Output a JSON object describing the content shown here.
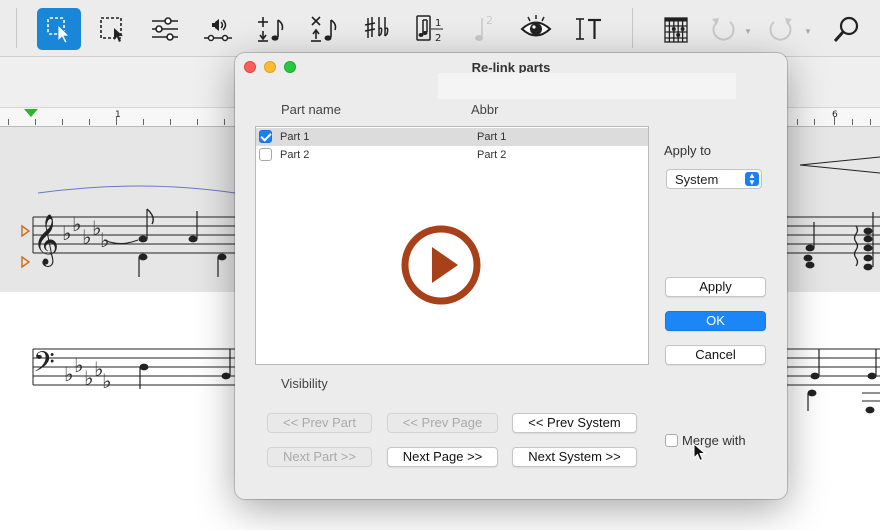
{
  "toolbar": {
    "icons": [
      "select-pointer",
      "marquee-select",
      "mixer-sliders",
      "playback-audio",
      "add-note",
      "remove-note",
      "accidentals",
      "tuplet",
      "velocity",
      "eye",
      "text-tool",
      "chord-diagram",
      "undo",
      "redo",
      "search"
    ],
    "note_digit": "2"
  },
  "ruler": {
    "marks": [
      "1",
      "6"
    ]
  },
  "dialog": {
    "title": "Re-link parts",
    "columns": {
      "name": "Part name",
      "abbr": "Abbr"
    },
    "parts": [
      {
        "name": "Part 1",
        "abbr": "Part 1",
        "checked": true,
        "selected": true
      },
      {
        "name": "Part 2",
        "abbr": "Part 2",
        "checked": false,
        "selected": false
      }
    ],
    "apply_to": {
      "label": "Apply to",
      "value": "System"
    },
    "buttons": {
      "apply": "Apply",
      "ok": "OK",
      "cancel": "Cancel",
      "prev_part": "<< Prev Part",
      "prev_page": "<< Prev Page",
      "prev_system": "<< Prev System",
      "next_part": "Next Part >>",
      "next_page": "Next Page >>",
      "next_system": "Next System >>"
    },
    "visibility_label": "Visibility",
    "merge_label": "Merge with"
  },
  "colors": {
    "accent": "#1a86f7",
    "play_icon": "#a8401a",
    "toolbar_active": "#1a86d8"
  }
}
